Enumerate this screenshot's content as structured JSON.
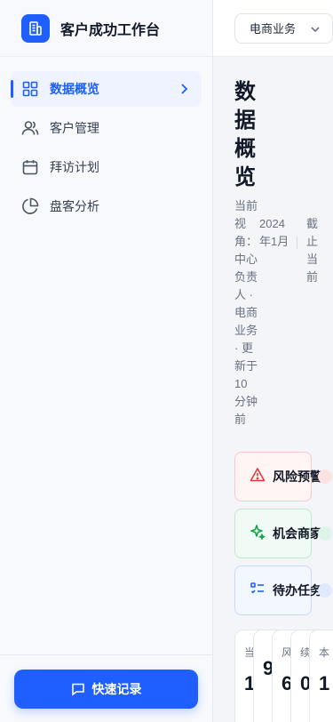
{
  "app": {
    "title": "客户成功工作台"
  },
  "sidebar": {
    "items": [
      {
        "label": "数据概览",
        "icon": "dashboard-icon",
        "active": true
      },
      {
        "label": "客户管理",
        "icon": "users-icon",
        "active": false
      },
      {
        "label": "拜访计划",
        "icon": "calendar-icon",
        "active": false
      },
      {
        "label": "盘客分析",
        "icon": "pie-chart-icon",
        "active": false
      }
    ],
    "quick_record_label": "快速记录"
  },
  "topbar": {
    "business_select": "电商业务"
  },
  "main": {
    "title": "数据概览",
    "meta_text": "当前视角：中心负责人 · 电商业务 · 更新于 10 分钟前",
    "date": "2024年1月",
    "cutoff": "截止当前",
    "cards": [
      {
        "label": "风险预警",
        "icon": "warning-icon"
      },
      {
        "label": "机会商家",
        "icon": "sparkle-icon"
      },
      {
        "label": "待办任务",
        "icon": "task-list-icon"
      }
    ],
    "stats": [
      {
        "label": "当",
        "value": "1"
      },
      {
        "label": "",
        "value": "9"
      },
      {
        "label": "风",
        "value": "6"
      },
      {
        "label": "续",
        "value": "0"
      },
      {
        "label": "本",
        "value": "1"
      }
    ]
  },
  "colors": {
    "accent": "#1f5eff",
    "risk": "#e03b3b",
    "opportunity": "#16a34a",
    "todo": "#1f5eff"
  }
}
